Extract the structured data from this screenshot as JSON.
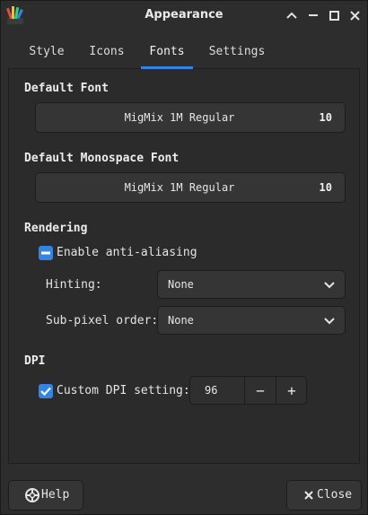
{
  "window": {
    "title": "Appearance"
  },
  "tabs": [
    {
      "label": "Style"
    },
    {
      "label": "Icons"
    },
    {
      "label": "Fonts"
    },
    {
      "label": "Settings"
    }
  ],
  "active_tab": "Fonts",
  "default_font": {
    "heading": "Default Font",
    "name": "MigMix 1M Regular",
    "size": "10"
  },
  "mono_font": {
    "heading": "Default Monospace Font",
    "name": "MigMix 1M Regular",
    "size": "10"
  },
  "rendering": {
    "heading": "Rendering",
    "antialias_label": "Enable anti-aliasing",
    "hinting_label": "Hinting:",
    "hinting_value": "None",
    "subpixel_label": "Sub-pixel order:",
    "subpixel_value": "None"
  },
  "dpi": {
    "heading": "DPI",
    "custom_label": "Custom DPI setting:",
    "value": "96",
    "minus": "−",
    "plus": "+"
  },
  "buttons": {
    "help": "Help",
    "close": "Close"
  },
  "colors": {
    "accent": "#3584e4",
    "background": "#2b2b2b"
  }
}
